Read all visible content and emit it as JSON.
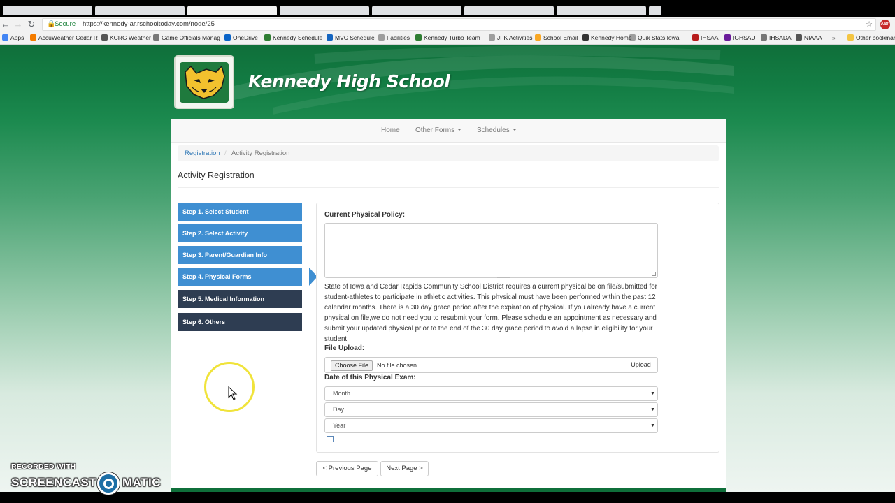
{
  "browser": {
    "secure_label": "Secure",
    "url": "https://kennedy-ar.rschooltoday.com/node/25",
    "overflow_label": "»",
    "abp_label": "ABP",
    "bookmarks": [
      {
        "label": "Apps",
        "color": "#4285f4"
      },
      {
        "label": "AccuWeather Cedar R",
        "color": "#f57c00"
      },
      {
        "label": "KCRG Weather",
        "color": "#555555"
      },
      {
        "label": "Game Officials Manag",
        "color": "#777777"
      },
      {
        "label": "OneDrive",
        "color": "#0a64c8"
      },
      {
        "label": "Kennedy Schedule",
        "color": "#2e7d32"
      },
      {
        "label": "MVC Schedule",
        "color": "#1565c0"
      },
      {
        "label": "Facilities",
        "color": "#9e9e9e"
      },
      {
        "label": "Kennedy Turbo Team",
        "color": "#2e7d32"
      },
      {
        "label": "JFK Activities",
        "color": "#9e9e9e"
      },
      {
        "label": "School Email",
        "color": "#f9a825"
      },
      {
        "label": "Kennedy Home",
        "color": "#333333"
      },
      {
        "label": "Quik Stats Iowa",
        "color": "#9e9e9e"
      },
      {
        "label": "IHSAA",
        "color": "#b71c1c"
      },
      {
        "label": "IGHSAU",
        "color": "#6a1b9a"
      },
      {
        "label": "IHSADA",
        "color": "#777777"
      },
      {
        "label": "NIAAA",
        "color": "#555555"
      }
    ],
    "other_bookmarks": "Other bookmarks"
  },
  "site": {
    "school_name": "Kennedy High School"
  },
  "navbar": {
    "home": "Home",
    "other_forms": "Other Forms",
    "schedules": "Schedules"
  },
  "breadcrumb": {
    "link": "Registration",
    "separator": "/",
    "current": "Activity Registration"
  },
  "page_title": "Activity Registration",
  "steps": [
    {
      "label": "Step 1. Select Student",
      "state": "done"
    },
    {
      "label": "Step 2. Select Activity",
      "state": "done"
    },
    {
      "label": "Step 3. Parent/Guardian Info",
      "state": "done"
    },
    {
      "label": "Step 4. Physical Forms",
      "state": "current"
    },
    {
      "label": "Step 5. Medical Information",
      "state": "todo"
    },
    {
      "label": "Step 6. Others",
      "state": "todo"
    }
  ],
  "form": {
    "policy_label": "Current Physical Policy:",
    "policy_text": "State of Iowa and Cedar Rapids Community School District requires a current physical be on file/submitted for student-athletes to participate in athletic activities. This physical must have been performed within the past 12 calendar months. There is a 30 day grace period after the expiration of physical. If you already have a current physical on file,we do not need you to resubmit your form. Please schedule an appointment as necessary and submit your updated physical prior to the end of the 30 day grace period to avoid a lapse in eligibility for your student",
    "file_upload_label": "File Upload:",
    "choose_file": "Choose File",
    "no_file": "No file chosen",
    "upload": "Upload",
    "date_label": "Date of this Physical Exam:",
    "month": "Month",
    "day": "Day",
    "year": "Year"
  },
  "pager": {
    "previous": "< Previous Page",
    "next": "Next Page >"
  },
  "watermark": {
    "top": "RECORDED WITH",
    "left": "SCREENCAST",
    "right": "MATIC"
  },
  "colors": {
    "brand_green": "#137d44",
    "step_done": "#3f8fd2",
    "step_todo": "#2e3d52",
    "link": "#337ab7"
  }
}
